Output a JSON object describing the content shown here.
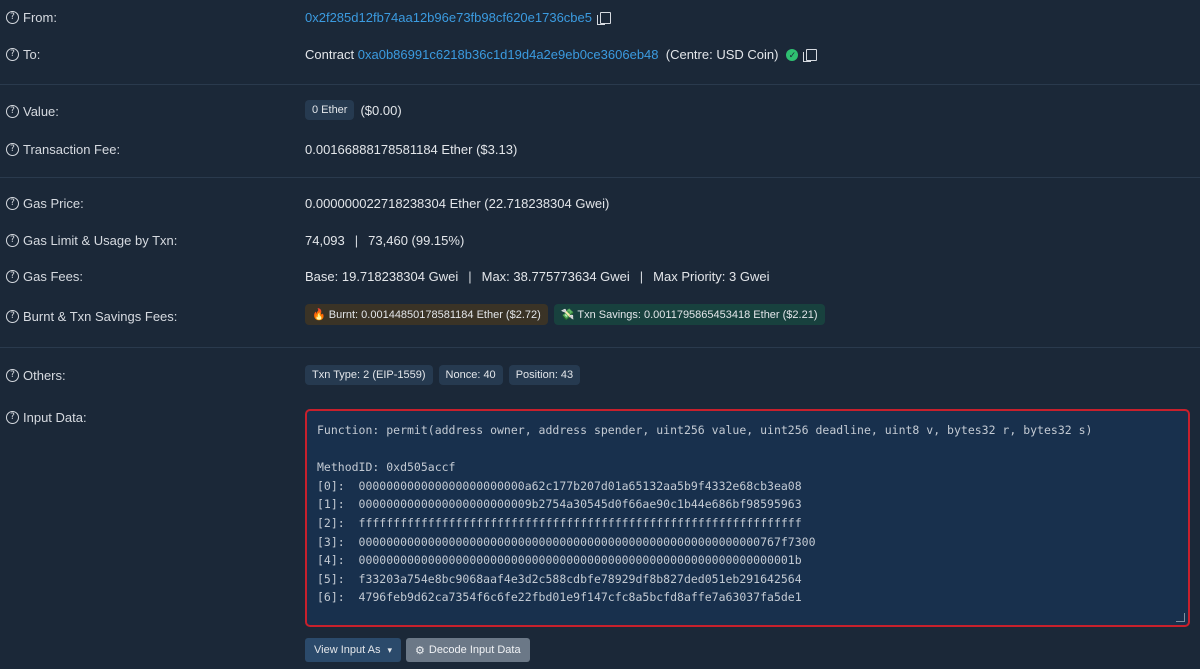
{
  "rows": {
    "from": {
      "label": "From:",
      "address": "0x2f285d12fb74aa12b96e73fb98cf620e1736cbe5"
    },
    "to": {
      "label": "To:",
      "prefix": "Contract",
      "address": "0xa0b86991c6218b36c1d19d4a2e9eb0ce3606eb48",
      "suffix": "(Centre: USD Coin)"
    },
    "value": {
      "label": "Value:",
      "badge": "0 Ether",
      "usd": "($0.00)"
    },
    "fee": {
      "label": "Transaction Fee:",
      "text": "0.00166888178581184 Ether ($3.13)"
    },
    "gas_price": {
      "label": "Gas Price:",
      "text": "0.000000022718238304 Ether (22.718238304 Gwei)"
    },
    "gas_limit": {
      "label": "Gas Limit & Usage by Txn:",
      "limit": "74,093",
      "sep": "|",
      "usage": "73,460 (99.15%)"
    },
    "gas_fees": {
      "label": "Gas Fees:",
      "base": "Base: 19.718238304 Gwei",
      "sep": "|",
      "max": "Max: 38.775773634 Gwei",
      "sep2": "|",
      "priority": "Max Priority: 3 Gwei"
    },
    "burnt": {
      "label": "Burnt & Txn Savings Fees:",
      "burnt_icon": "🔥",
      "burnt_text": "Burnt: 0.00144850178581184 Ether ($2.72)",
      "save_icon": "💸",
      "save_text": "Txn Savings: 0.0011795865453418 Ether ($2.21)"
    },
    "others": {
      "label": "Others:",
      "txn_type": "Txn Type: 2 (EIP-1559)",
      "nonce": "Nonce: 40",
      "position": "Position: 43"
    },
    "input": {
      "label": "Input Data:",
      "function": "Function: permit(address owner, address spender, uint256 value, uint256 deadline, uint8 v, bytes32 r, bytes32 s)",
      "method_id": "MethodID: 0xd505accf",
      "params": [
        "[0]:  000000000000000000000000a62c177b207d01a65132aa5b9f4332e68cb3ea08",
        "[1]:  0000000000000000000000009b2754a30545d0f66ae90c1b44e686bf98595963",
        "[2]:  ffffffffffffffffffffffffffffffffffffffffffffffffffffffffffffffff",
        "[3]:  0000000000000000000000000000000000000000000000000000000000767f7300",
        "[4]:  000000000000000000000000000000000000000000000000000000000000001b",
        "[5]:  f33203a754e8bc9068aaf4e3d2c588cdbfe78929df8b827ded051eb291642564",
        "[6]:  4796feb9d62ca7354f6c6fe22fbd01e9f147cfc8a5bcfd8affe7a63037fa5de1"
      ]
    }
  },
  "buttons": {
    "view_input_as": "View Input As",
    "decode": "Decode Input Data",
    "decode_icon": "⚙"
  },
  "colors": {
    "link": "#3b9be0",
    "background": "#1b2838",
    "highlight_border": "#c8202c"
  }
}
